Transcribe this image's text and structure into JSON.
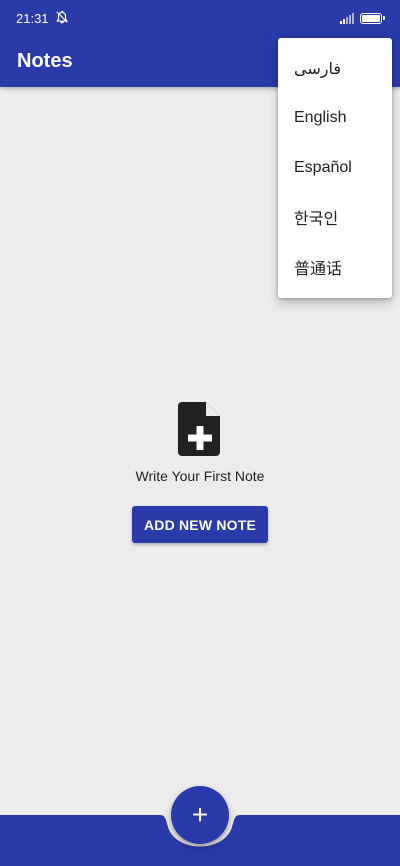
{
  "status_bar": {
    "time": "21:31"
  },
  "app_bar": {
    "title": "Notes"
  },
  "language_menu": {
    "items": [
      {
        "label": "فارسی"
      },
      {
        "label": "English"
      },
      {
        "label": "Español"
      },
      {
        "label": "한국인"
      },
      {
        "label": "普通话"
      }
    ]
  },
  "empty_state": {
    "message": "Write Your First Note",
    "button_label": "ADD NEW NOTE"
  },
  "fab": {
    "icon": "plus-icon",
    "label": "+"
  },
  "colors": {
    "primary": "#2a3aa8",
    "background": "#ececec",
    "menu_background": "#ffffff"
  }
}
